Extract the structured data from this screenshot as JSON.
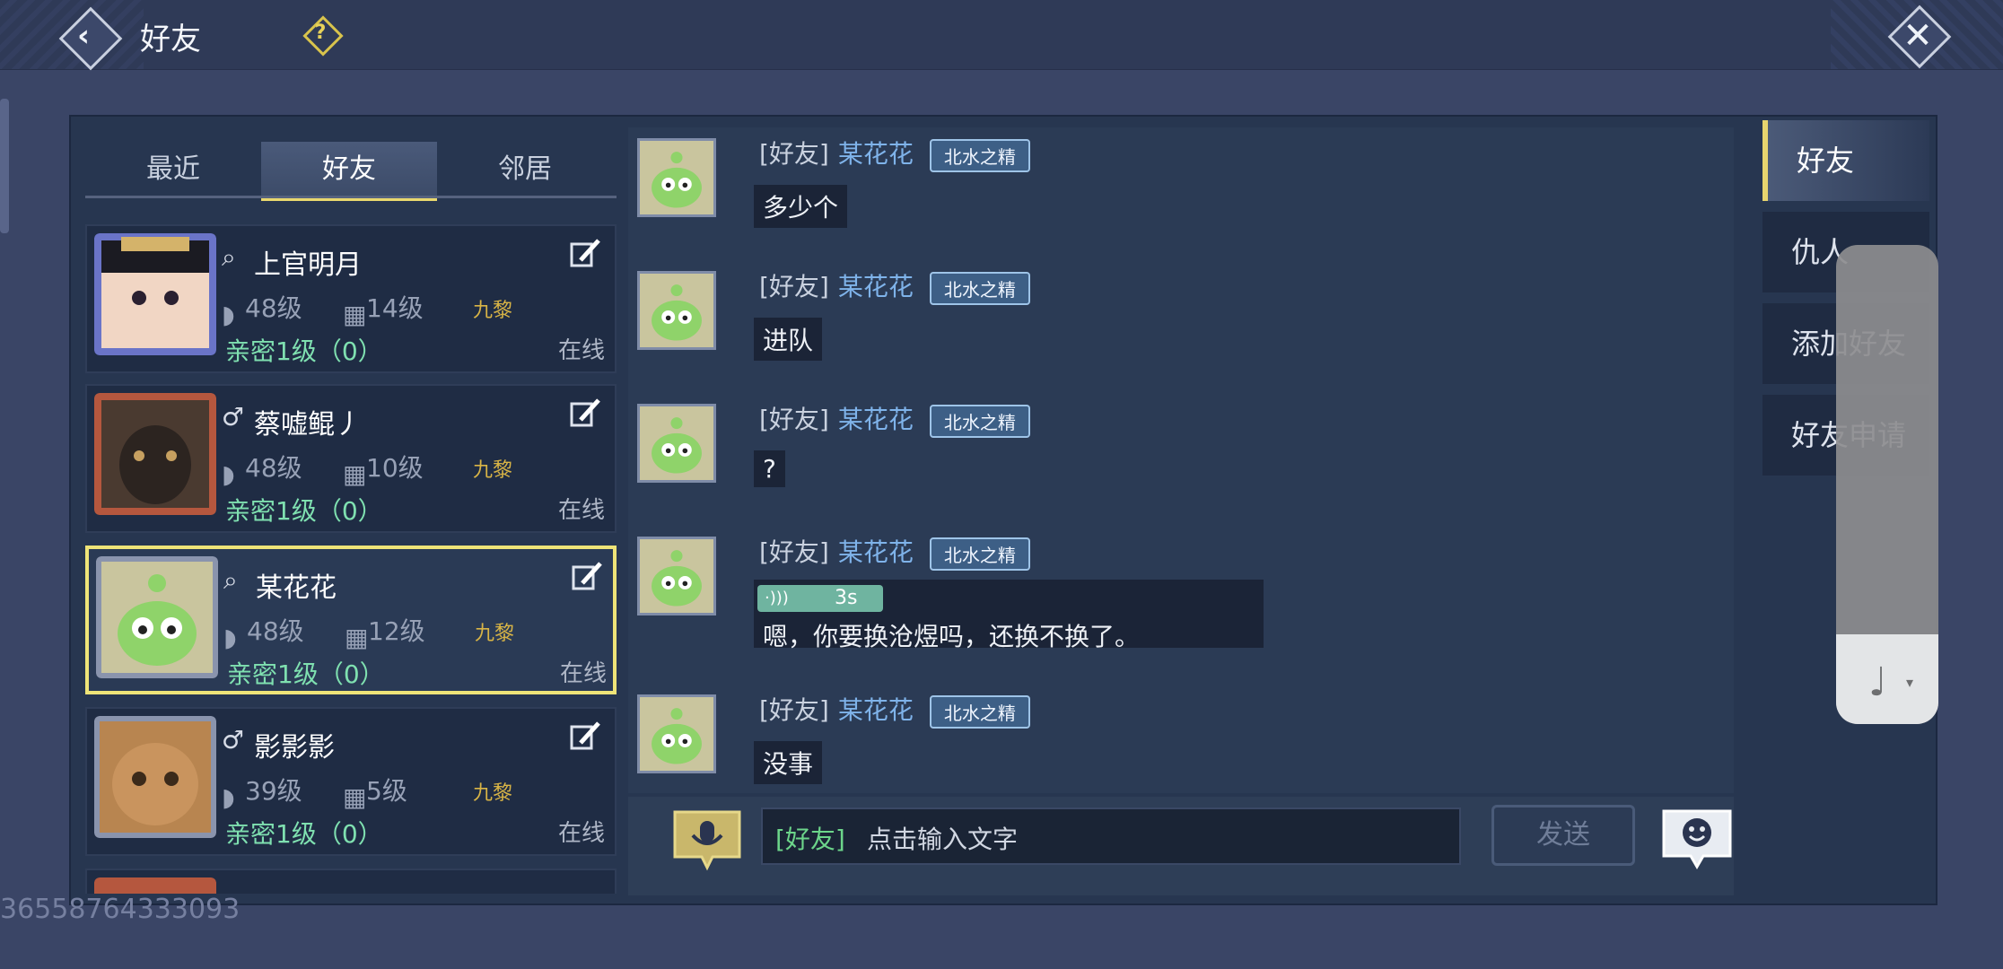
{
  "header": {
    "title": "好友",
    "help_icon": "question-diamond-icon",
    "back_icon": "back-arrow-icon",
    "close_icon": "close-x-icon"
  },
  "tabs": [
    {
      "label": "最近"
    },
    {
      "label": "好友",
      "active": true
    },
    {
      "label": "邻居"
    }
  ],
  "friends": [
    {
      "name": "上官明月",
      "level": "48级",
      "level2": "14级",
      "guild": "九黎",
      "intimacy": "亲密1级（0）",
      "status": "在线",
      "gender_icon": "search-icon"
    },
    {
      "name": "蔡嘘鲲丿",
      "level": "48级",
      "level2": "10级",
      "guild": "九黎",
      "intimacy": "亲密1级（0）",
      "status": "在线",
      "gender_icon": "male-icon"
    },
    {
      "name": "某花花",
      "level": "48级",
      "level2": "12级",
      "guild": "九黎",
      "intimacy": "亲密1级（0）",
      "status": "在线",
      "gender_icon": "search-icon",
      "selected": true
    },
    {
      "name": "影影影",
      "level": "39级",
      "level2": "5级",
      "guild": "九黎",
      "intimacy": "亲密1级（0）",
      "status": "在线",
      "gender_icon": "male-icon"
    }
  ],
  "messages": [
    {
      "channel": "[好友]",
      "sender": "某花花",
      "badge": "北水之精",
      "text": "多少个"
    },
    {
      "channel": "[好友]",
      "sender": "某花花",
      "badge": "北水之精",
      "text": "进队"
    },
    {
      "channel": "[好友]",
      "sender": "某花花",
      "badge": "北水之精",
      "text": "?"
    },
    {
      "channel": "[好友]",
      "sender": "某花花",
      "badge": "北水之精",
      "voice_duration": "3s",
      "text": "嗯，你要换沧煜吗，还换不换了。"
    },
    {
      "channel": "[好友]",
      "sender": "某花花",
      "badge": "北水之精",
      "text": "没事"
    }
  ],
  "input": {
    "channel": "[好友]",
    "placeholder": "点击输入文字",
    "send_label": "发送"
  },
  "side_tabs": [
    {
      "label": "好友",
      "active": true
    },
    {
      "label": "仇人"
    },
    {
      "label": "添加好友"
    },
    {
      "label": "好友申请"
    }
  ],
  "watermark": "36558764333093",
  "colors": {
    "accent_yellow": "#efe478",
    "intimacy_green": "#7fe0b0",
    "name_blue": "#7fb3ea",
    "channel_green": "#6cd58a"
  }
}
